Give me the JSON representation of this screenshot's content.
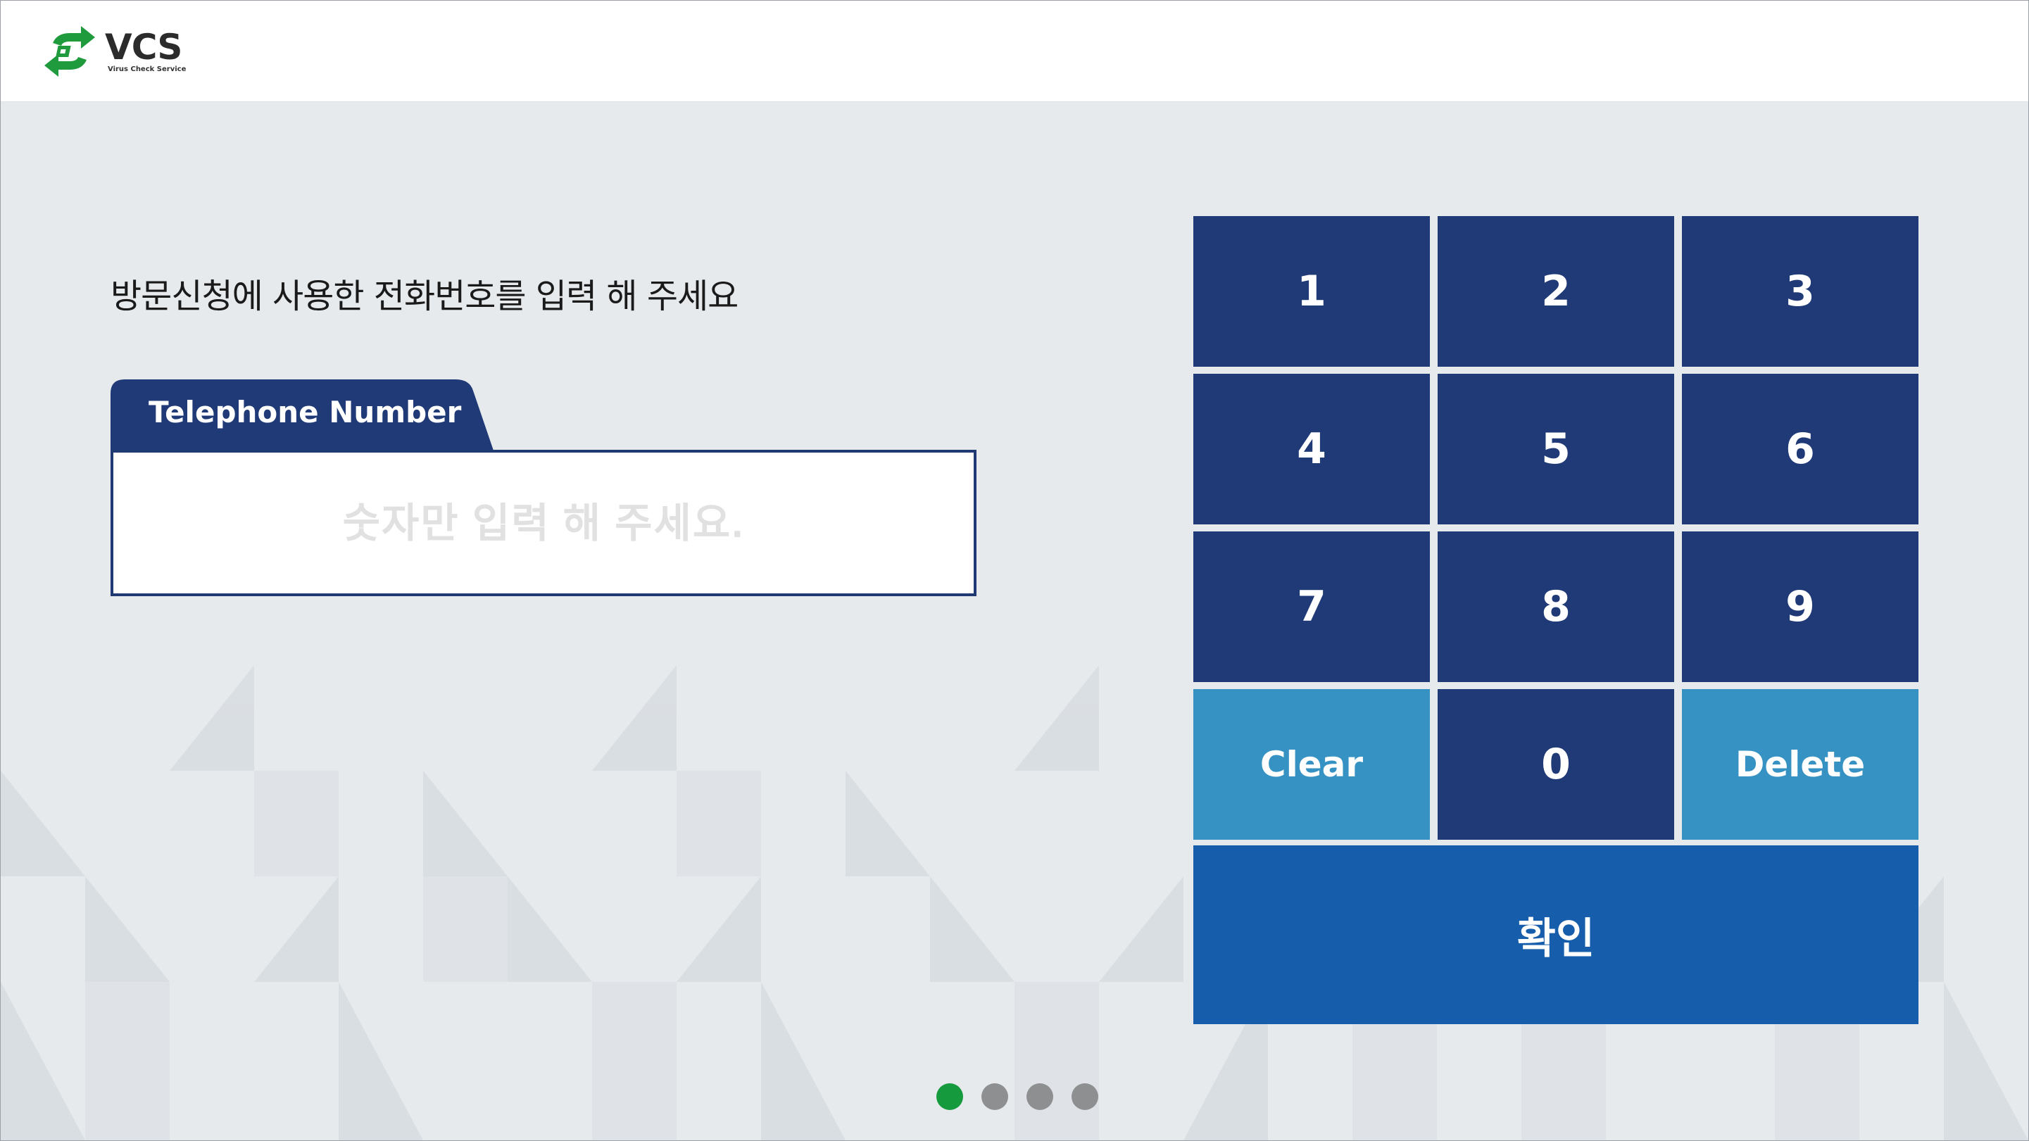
{
  "brand": {
    "title": "VCS",
    "subtitle": "Virus Check Service",
    "logo_icon": "refresh-arrows-icon",
    "green": "#1f9a3c"
  },
  "prompt": "방문신청에 사용한 전화번호를 입력 해 주세요",
  "phone_field": {
    "label": "Telephone Number",
    "value": "",
    "placeholder": "숫자만 입력 해 주세요."
  },
  "keypad": {
    "digits": [
      "1",
      "2",
      "3",
      "4",
      "5",
      "6",
      "7",
      "8",
      "9"
    ],
    "clear": "Clear",
    "zero": "0",
    "delete": "Delete",
    "confirm": "확인"
  },
  "colors": {
    "key_dark": "#1f3a77",
    "key_light": "#3592c3",
    "confirm": "#165eab",
    "dot_active": "#159a3e",
    "dot_inactive": "#8d8f91"
  },
  "pagination": {
    "total": 4,
    "active_index": 0
  }
}
